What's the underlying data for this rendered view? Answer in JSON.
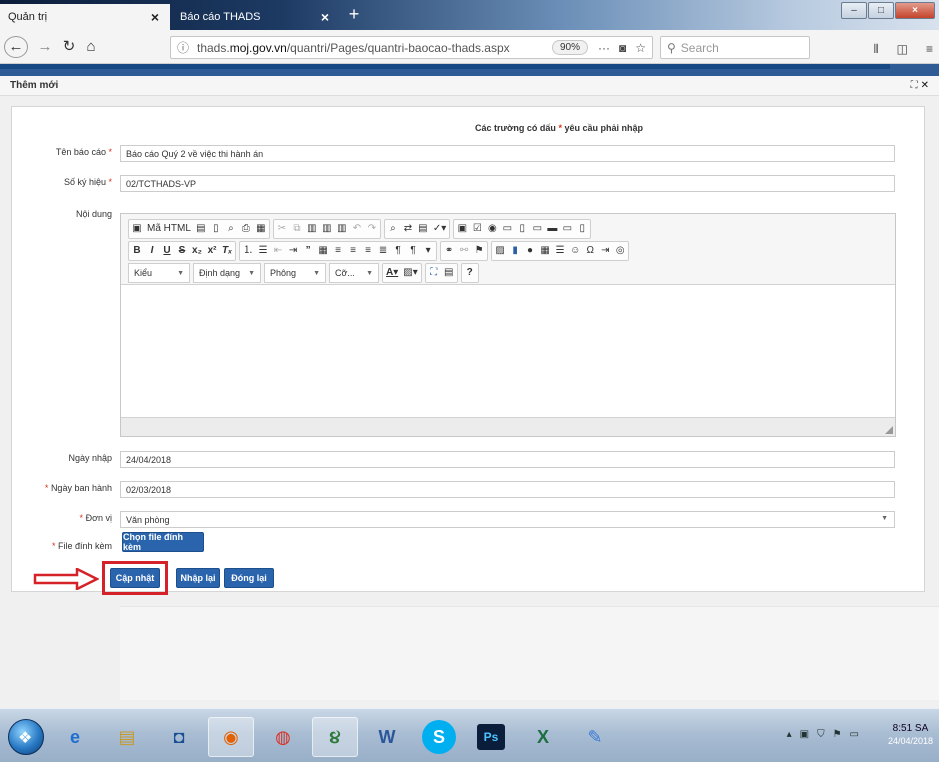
{
  "browser": {
    "tabs": [
      {
        "label": "Quản trị"
      },
      {
        "label": "Báo cáo THADS"
      }
    ],
    "new_tab": "+",
    "url_prefix": "thads.",
    "url_domain": "moj.gov.vn",
    "url_path": "/quantri/Pages/quantri-baocao-thads.aspx",
    "zoom": "90%",
    "search_placeholder": "Search"
  },
  "dialog": {
    "title": "Thêm mới",
    "tools": "✕"
  },
  "form": {
    "required_note_prefix": "Các trường có dấu ",
    "required_note_star": "*",
    "required_note_suffix": " yêu cầu phải nhập",
    "fields": {
      "report_name": {
        "label": "Tên báo cáo",
        "required": "*",
        "value": "Báo cáo Quý 2 về việc thi hành án"
      },
      "symbol": {
        "label": "Số ký hiệu",
        "required": "*",
        "value": "02/TCTHADS-VP"
      },
      "content": {
        "label": "Nội dung"
      },
      "input_date": {
        "label": "Ngày nhập",
        "value": "24/04/2018"
      },
      "issue_date": {
        "label": "Ngày ban hành",
        "required": "*",
        "value": "02/03/2018"
      },
      "unit": {
        "label": "Đơn vị",
        "required": "*",
        "value": "Văn phòng"
      },
      "attachment": {
        "label": "File đính kèm",
        "required": "*",
        "button": "Chọn file đính kèm"
      }
    },
    "editor": {
      "source_label": "Mã HTML",
      "style_combo": "Kiểu",
      "format_combo": "Định dạng",
      "font_combo": "Phông",
      "size_combo": "Cỡ..."
    },
    "buttons": {
      "update": "Cập nhật",
      "reset": "Nhập lại",
      "close": "Đóng lại"
    }
  },
  "taskbar": {
    "time": "8:51 SA",
    "date": "24/04/2018"
  }
}
